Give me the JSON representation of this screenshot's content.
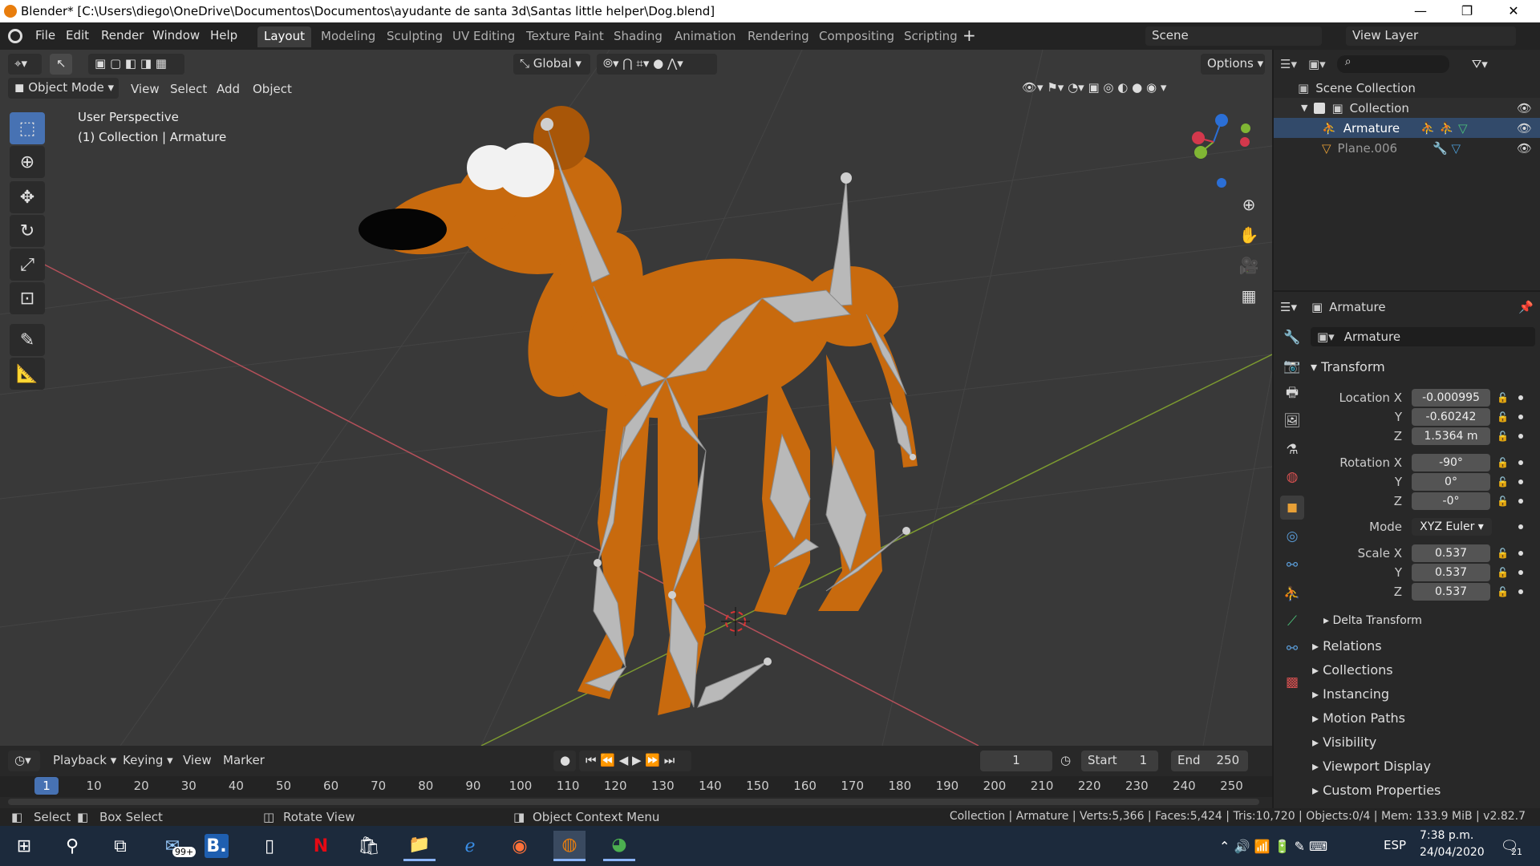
{
  "window": {
    "title": "Blender* [C:\\Users\\diego\\OneDrive\\Documentos\\Documentos\\ayudante de santa 3d\\Santas little helper\\Dog.blend]",
    "min": "—",
    "max": "❐",
    "close": "✕"
  },
  "menus": [
    "File",
    "Edit",
    "Render",
    "Window",
    "Help"
  ],
  "workspaces": [
    "Layout",
    "Modeling",
    "Sculpting",
    "UV Editing",
    "Texture Paint",
    "Shading",
    "Animation",
    "Rendering",
    "Compositing",
    "Scripting"
  ],
  "scene": "Scene",
  "view_layer": "View Layer",
  "viewport": {
    "transform_orient": "Global",
    "options": "Options",
    "mode": "Object Mode",
    "menu": [
      "View",
      "Select",
      "Add",
      "Object"
    ],
    "overlay1": "User Perspective",
    "overlay2": "(1) Collection | Armature"
  },
  "outliner": {
    "scene_collection": "Scene Collection",
    "collection": "Collection",
    "armature": "Armature",
    "plane": "Plane.006"
  },
  "props": {
    "header": "Armature",
    "name": "Armature",
    "transform": "Transform",
    "loc_label": "Location X",
    "y": "Y",
    "z": "Z",
    "loc": [
      "-0.000995",
      "-0.60242",
      "1.5364 m"
    ],
    "rot_label": "Rotation X",
    "rot": [
      "-90°",
      "0°",
      "-0°"
    ],
    "mode_label": "Mode",
    "mode": "XYZ Euler",
    "scale_label": "Scale X",
    "scale": [
      "0.537",
      "0.537",
      "0.537"
    ],
    "delta": "Delta Transform",
    "sections": [
      "Relations",
      "Collections",
      "Instancing",
      "Motion Paths",
      "Visibility",
      "Viewport Display",
      "Custom Properties"
    ]
  },
  "timeline": {
    "menu": [
      "Playback",
      "Keying",
      "View",
      "Marker"
    ],
    "frame": "1",
    "start_label": "Start",
    "start": "1",
    "end_label": "End",
    "end": "250",
    "ticks": [
      "1",
      "10",
      "20",
      "30",
      "40",
      "50",
      "60",
      "70",
      "80",
      "90",
      "100",
      "110",
      "120",
      "130",
      "140",
      "150",
      "160",
      "170",
      "180",
      "190",
      "200",
      "210",
      "220",
      "230",
      "240",
      "250"
    ]
  },
  "status": {
    "select": "Select",
    "box": "Box Select",
    "rotate": "Rotate View",
    "context": "Object Context Menu",
    "info": "Collection | Armature | Verts:5,366 | Faces:5,424 | Tris:10,720 | Objects:0/4 | Mem: 133.9 MiB | v2.82.7"
  },
  "taskbar": {
    "badge": "99+",
    "lang": "ESP",
    "time": "7:38 p.m.",
    "date": "24/04/2020",
    "notif": "21"
  },
  "colors": {
    "accent": "#4772b3",
    "dog": "#c86a0e",
    "bone": "#b9b9b9"
  }
}
